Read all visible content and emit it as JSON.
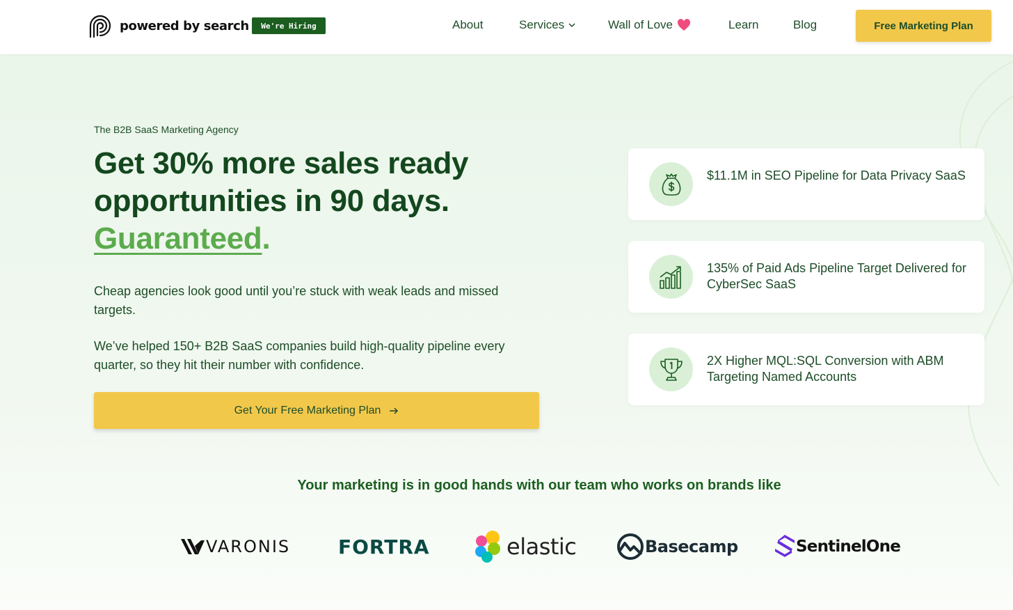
{
  "header": {
    "logo_text": "powered by search",
    "hiring_badge": "We're Hiring",
    "nav": [
      {
        "label": "About"
      },
      {
        "label": "Services",
        "icon": "chevron-down-icon"
      },
      {
        "label": "Wall of Love",
        "icon": "heart-icon"
      },
      {
        "label": "Learn"
      },
      {
        "label": "Blog"
      }
    ],
    "cta_label": "Free Marketing Plan"
  },
  "hero": {
    "eyebrow": "The B2B SaaS Marketing Agency",
    "headline_line1": "Get 30% more sales ready",
    "headline_line2": "opportunities in 90 days.",
    "headline_accent": "Guaranteed",
    "headline_dot": ".",
    "paragraph_1": "Cheap agencies look good until you’re stuck with weak leads and missed targets.",
    "paragraph_2": "We’ve helped 150+ B2B SaaS companies build high-quality pipeline every quarter, so they hit their number with confidence.",
    "cta_label": "Get Your Free Marketing Plan"
  },
  "stats": [
    {
      "icon": "money-bag-icon",
      "text": "$11.1M in SEO Pipeline for Data Privacy SaaS"
    },
    {
      "icon": "growth-chart-icon",
      "text": "135% of Paid Ads Pipeline Target Delivered for CyberSec SaaS"
    },
    {
      "icon": "trophy-icon",
      "text": "2X Higher MQL:SQL Conversion with ABM Targeting Named Accounts"
    }
  ],
  "brands": {
    "heading": "Your marketing is in good hands with our team who works on brands like",
    "logos": [
      "VARONIS",
      "FORTRA",
      "elastic",
      "Basecamp",
      "SentinelOne"
    ]
  },
  "colors": {
    "brand_green": "#14471e",
    "accent_green": "#5cab4e",
    "cta_yellow": "#f2c84b",
    "hero_bg": "#eaf6ea"
  }
}
